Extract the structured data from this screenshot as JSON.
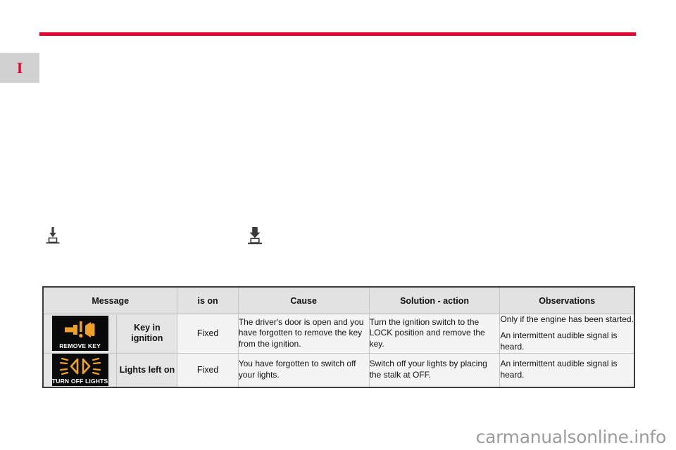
{
  "page": {
    "chapter_tab_label": "I",
    "rule_color": "#e4032e",
    "watermark": "carmanualsonline.info"
  },
  "press_icons": [
    {
      "name": "insert-press-icon-small",
      "caption": ""
    },
    {
      "name": "insert-press-icon-large",
      "caption": ""
    }
  ],
  "table": {
    "headers": {
      "message": "Message",
      "is_on": "is on",
      "cause": "Cause",
      "solution": "Solution - action",
      "observations": "Observations"
    },
    "rows": [
      {
        "telltale_caption": "REMOVE KEY",
        "telltale_icon": "key-warning-icon",
        "telltale_color": "#f0a028",
        "message": "Key in ignition",
        "is_on": "Fixed",
        "cause": [
          "The driver's door is open and you have forgotten to remove the key from the ignition."
        ],
        "solution": [
          "Turn the ignition switch to the LOCK position and remove the key."
        ],
        "observations": [
          "Only if the engine has been started.",
          "An intermittent audible signal is heard."
        ]
      },
      {
        "telltale_caption": "TURN OFF LIGHTS",
        "telltale_icon": "headlights-icon",
        "telltale_color": "#f0a028",
        "message": "Lights left on",
        "is_on": "Fixed",
        "cause": [
          "You have forgotten to switch off your lights."
        ],
        "solution": [
          "Switch off your lights by placing the stalk at OFF."
        ],
        "observations": [
          "An intermittent audible signal is heard."
        ]
      }
    ]
  }
}
